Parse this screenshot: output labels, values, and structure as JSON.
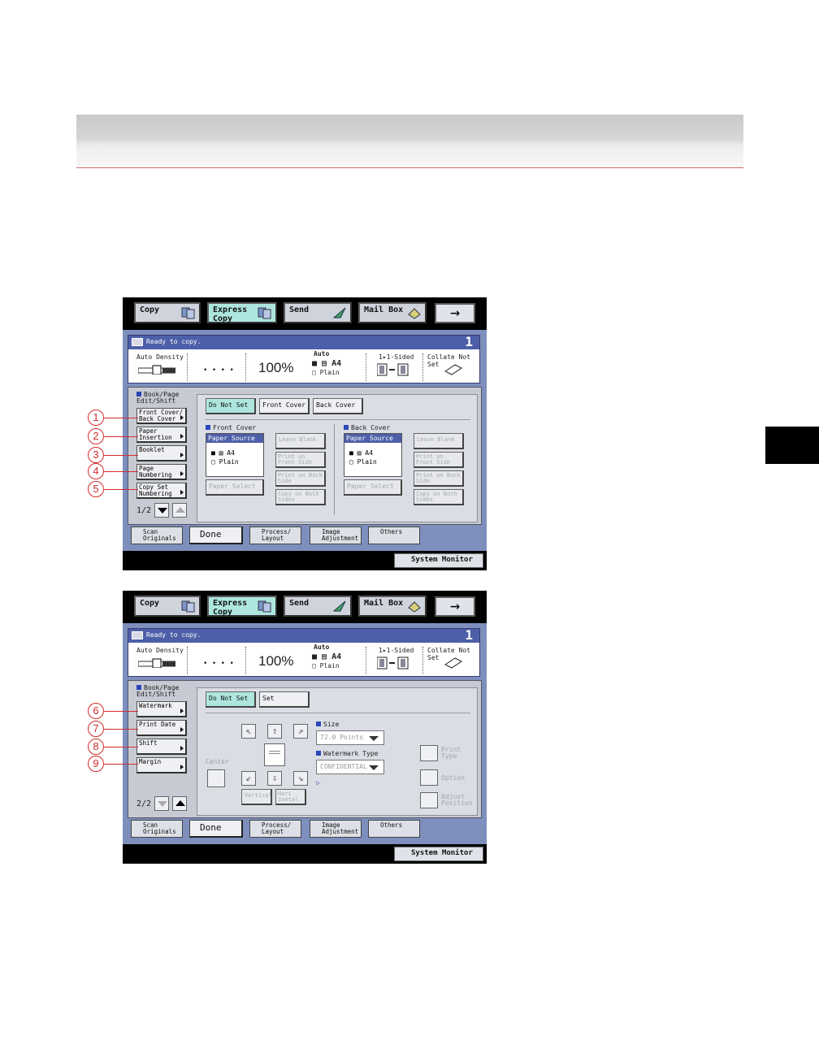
{
  "tabs": {
    "copy": "Copy",
    "express": "Express Copy",
    "send": "Send",
    "mailbox": "Mail Box"
  },
  "status": {
    "message": "Ready to copy.",
    "count": "1",
    "density": "Auto Density",
    "dots": "• • • •",
    "zoom": "100%",
    "paper_auto": "Auto",
    "paper_size": "A4",
    "paper_type": "Plain",
    "sided": "1▸1-Sided",
    "collate": "Collate Not Set"
  },
  "screen1": {
    "panel_title": "Book/Page Edit/Shift",
    "left_buttons": [
      "Front Cover/ Back Cover",
      "Paper Insertion",
      "Booklet",
      "Page Numbering",
      "Copy Set Numbering"
    ],
    "page": "1/2",
    "top_options": [
      "Do Not Set",
      "Front Cover",
      "Back Cover"
    ],
    "front_cover": {
      "heading": "Front Cover",
      "source_title": "Paper Source",
      "size": "A4",
      "type": "Plain",
      "paper_select": "Paper Select",
      "options": [
        "Leave Blank",
        "Print on Front Side",
        "Print on Back Side",
        "Copy on Both Sides"
      ]
    },
    "back_cover": {
      "heading": "Back Cover",
      "source_title": "Paper Source",
      "size": "A4",
      "type": "Plain",
      "paper_select": "Paper Select",
      "options": [
        "Leave Blank",
        "Print on Front Side",
        "Print on Back Side",
        "Copy on Both Sides"
      ]
    }
  },
  "screen2": {
    "panel_title": "Book/Page Edit/Shift",
    "left_buttons": [
      "Watermark",
      "Print Date",
      "Shift",
      "Margin"
    ],
    "page": "2/2",
    "top_options": [
      "Do Not Set",
      "Set"
    ],
    "center": "Center",
    "vertical": "Vertical",
    "horizontal": "Hori zontal",
    "size_heading": "Size",
    "size_value": "72.0 Points",
    "watermark_type_heading": "Watermark Type",
    "watermark_type_value": "CONFIDENTIAL",
    "right_options": [
      "Print Type",
      "Option",
      "Adjust Position"
    ]
  },
  "bottom": {
    "scan": "Scan Originals",
    "done": "Done",
    "process": "Process/ Layout",
    "image": "Image Adjustment",
    "others": "Others",
    "system_monitor": "System Monitor"
  },
  "callouts": [
    "1",
    "2",
    "3",
    "4",
    "5",
    "6",
    "7",
    "8",
    "9"
  ]
}
